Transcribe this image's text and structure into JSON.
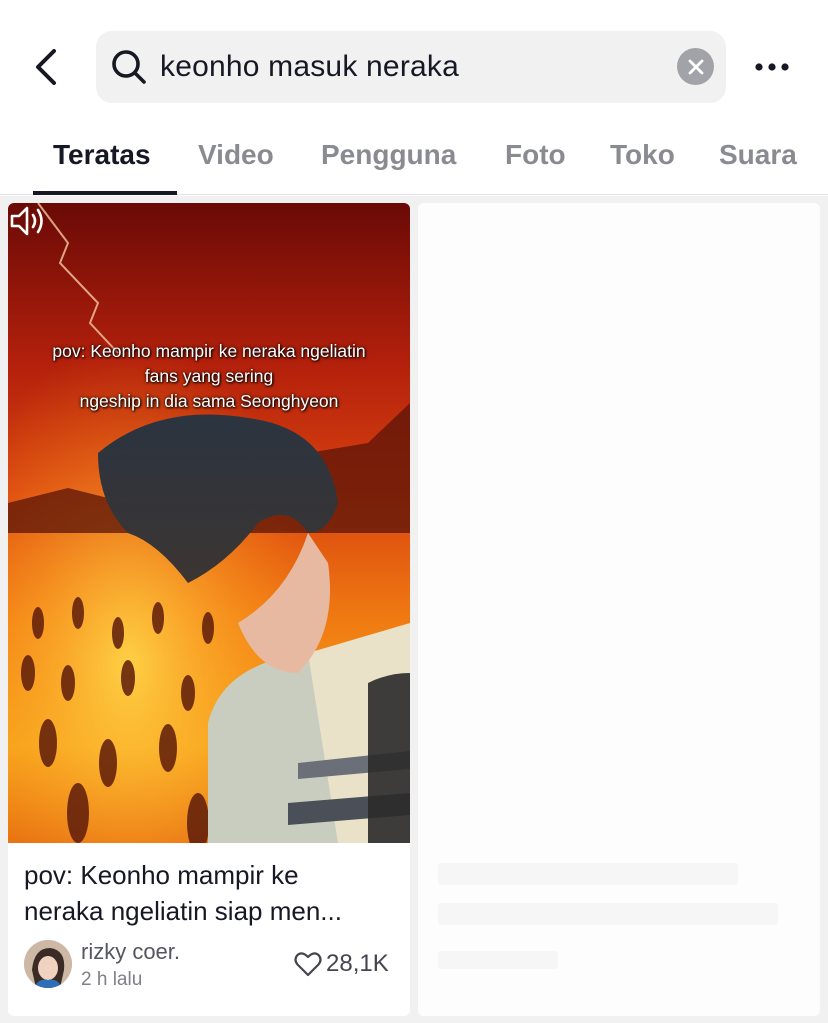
{
  "search": {
    "query": "keonho masuk neraka"
  },
  "tabs": [
    {
      "label": "Teratas",
      "active": true
    },
    {
      "label": "Video",
      "active": false
    },
    {
      "label": "Pengguna",
      "active": false
    },
    {
      "label": "Foto",
      "active": false
    },
    {
      "label": "Toko",
      "active": false
    },
    {
      "label": "Suara",
      "active": false
    }
  ],
  "results": [
    {
      "overlay_caption": [
        "pov: Keonho mampir ke neraka ngeliatin",
        "fans yang sering",
        "ngeship in dia sama Seonghyeon"
      ],
      "title_lines": [
        "pov: Keonho mampir ke",
        "neraka ngeliatin siap men..."
      ],
      "author": "rizky coer.",
      "time": "2 h lalu",
      "likes": "28,1K"
    }
  ],
  "icons": {
    "back": "chevron-left-icon",
    "search": "search-icon",
    "clear": "close-icon",
    "more": "more-horizontal-icon",
    "sound": "speaker-icon",
    "like": "heart-icon"
  },
  "colors": {
    "text_primary": "#161823",
    "text_secondary": "#8a8b91",
    "search_bg": "#f1f1f2",
    "clear_bg": "#a2a3a8"
  }
}
